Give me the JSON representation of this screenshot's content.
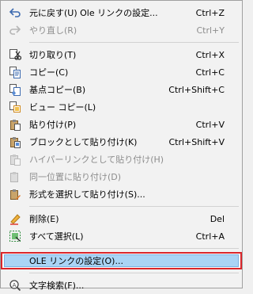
{
  "menu": {
    "undo": {
      "label": "元に戻す(U) Ole リンクの設定...",
      "shortcut": "Ctrl+Z"
    },
    "redo": {
      "label": "やり直し(R)",
      "shortcut": "Ctrl+Y"
    },
    "cut": {
      "label": "切り取り(T)",
      "shortcut": "Ctrl+X"
    },
    "copy": {
      "label": "コピー(C)",
      "shortcut": "Ctrl+C"
    },
    "basepoint_copy": {
      "label": "基点コピー(B)",
      "shortcut": "Ctrl+Shift+C"
    },
    "view_copy": {
      "label": "ビュー コピー(L)",
      "shortcut": ""
    },
    "paste": {
      "label": "貼り付け(P)",
      "shortcut": "Ctrl+V"
    },
    "paste_block": {
      "label": "ブロックとして貼り付け(K)",
      "shortcut": "Ctrl+Shift+V"
    },
    "paste_hyperlink": {
      "label": "ハイパーリンクとして貼り付け(H)",
      "shortcut": ""
    },
    "paste_same_position": {
      "label": "同一位置に貼り付け(D)",
      "shortcut": ""
    },
    "paste_special": {
      "label": "形式を選択して貼り付け(S)...",
      "shortcut": ""
    },
    "delete": {
      "label": "削除(E)",
      "shortcut": "Del"
    },
    "select_all": {
      "label": "すべて選択(L)",
      "shortcut": "Ctrl+A"
    },
    "ole_links": {
      "label": "OLE リンクの設定(O)...",
      "shortcut": ""
    },
    "find": {
      "label": "文字検索(F)...",
      "shortcut": ""
    }
  }
}
